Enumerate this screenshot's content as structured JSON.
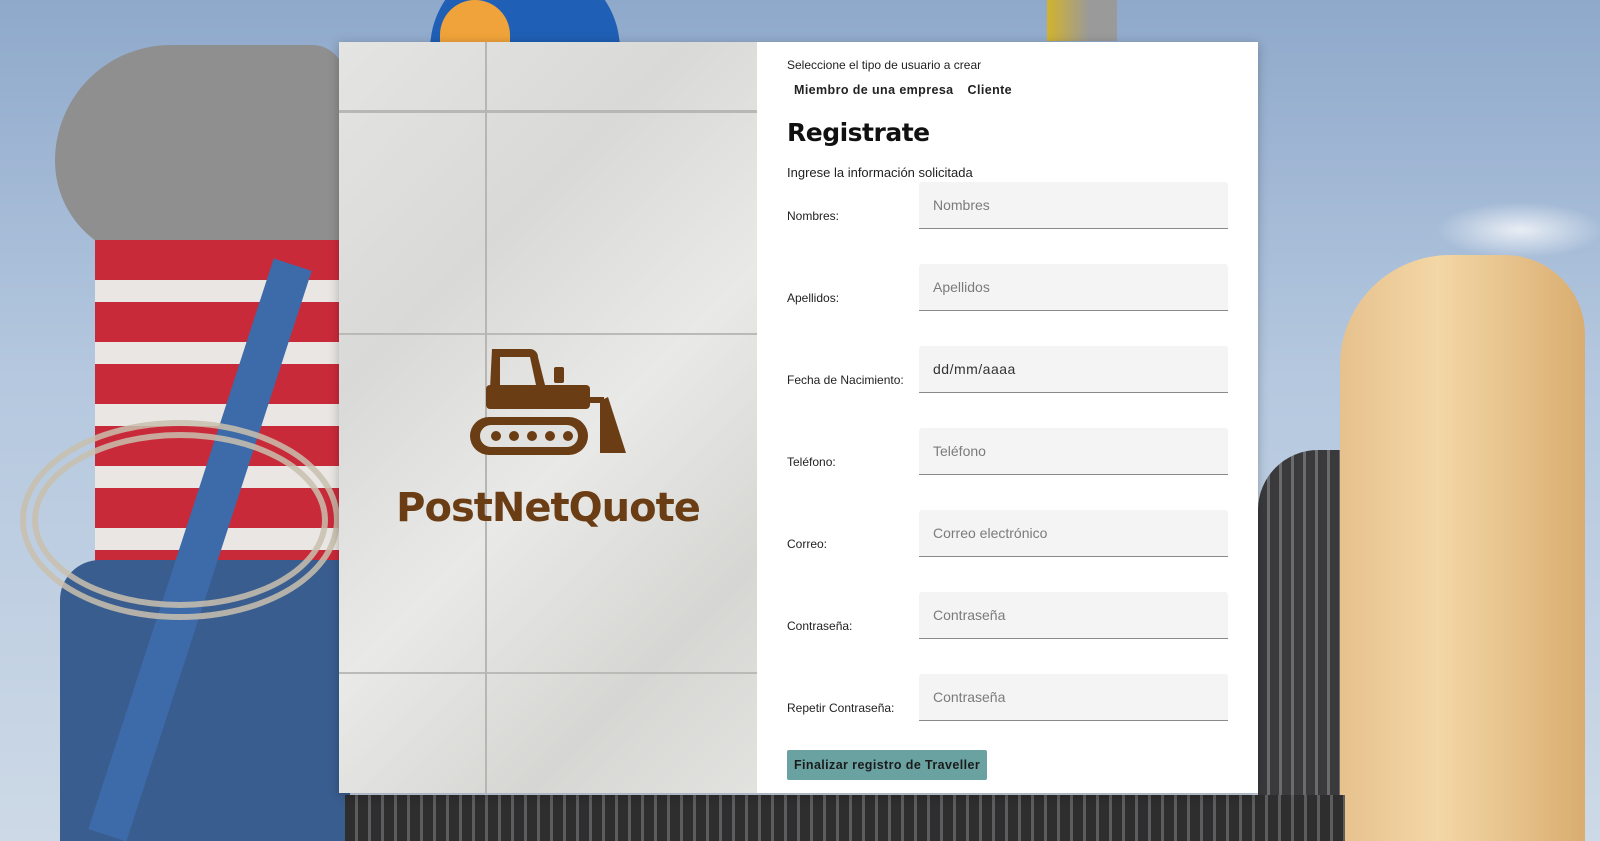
{
  "brand": {
    "name": "PostNetQuote",
    "color": "#6b3d14"
  },
  "user_type": {
    "prompt": "Seleccione el tipo de usuario a crear",
    "options": [
      "Miembro de una empresa",
      "Cliente"
    ]
  },
  "form": {
    "title": "Registrate",
    "subtitle": "Ingrese la información solicitada",
    "fields": [
      {
        "label": "Nombres:",
        "placeholder": "Nombres"
      },
      {
        "label": "Apellidos:",
        "placeholder": "Apellidos"
      },
      {
        "label": "Fecha de Nacimiento:",
        "value": "dd/mm/aaaa"
      },
      {
        "label": "Teléfono:",
        "placeholder": "Teléfono"
      },
      {
        "label": "Correo:",
        "placeholder": "Correo electrónico"
      },
      {
        "label": "Contraseña:",
        "placeholder": "Contraseña"
      },
      {
        "label": "Repetir Contraseña:",
        "placeholder": "Contraseña"
      }
    ],
    "submit_label": "Finalizar registro de Traveller",
    "submit_color": "#6aa2a2"
  }
}
